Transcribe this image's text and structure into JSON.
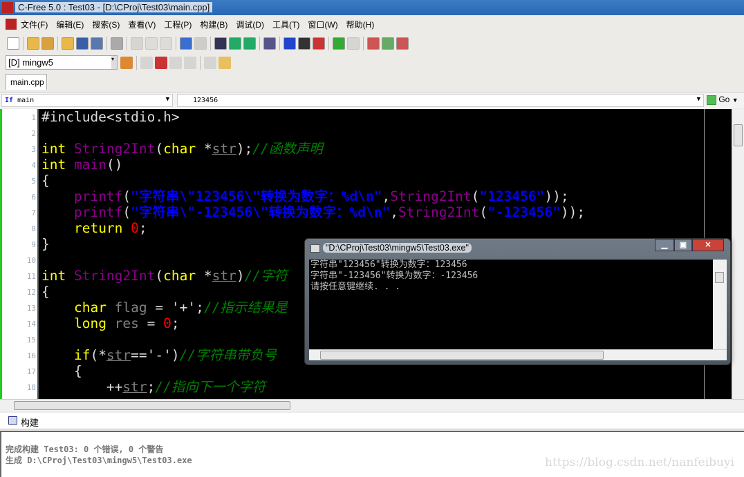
{
  "window": {
    "title": "C-Free 5.0 : Test03 - [D:\\CProj\\Test03\\main.cpp]",
    "logo": "CF"
  },
  "menu": [
    "文件(F)",
    "编辑(E)",
    "搜索(S)",
    "查看(V)",
    "工程(P)",
    "构建(B)",
    "调试(D)",
    "工具(T)",
    "窗口(W)",
    "帮助(H)"
  ],
  "toolbar1": [
    "new-file-icon",
    "open-folder-icon",
    "open-project-icon",
    "open-icon",
    "save-icon",
    "save-all-icon",
    "print-icon",
    "cut-icon",
    "copy-icon",
    "paste-icon",
    "undo-icon",
    "redo-icon",
    "find-icon",
    "find-next-icon",
    "find-prev-icon",
    "find-in-files-icon",
    "bookmark-icon",
    "bookmark-config-icon",
    "clear-bookmark-icon",
    "back-icon",
    "forward-icon",
    "build-icon",
    "run-icon",
    "clear-icon"
  ],
  "toolbar2": {
    "compiler": "[D] mingw5",
    "icons": [
      "switch-compiler-icon",
      "run-icon",
      "stop-icon",
      "step-over-icon",
      "step-into-icon",
      "breakpoints-icon",
      "hand-icon"
    ]
  },
  "tabs": [
    {
      "label": "main.cpp",
      "active": true
    }
  ],
  "navbar": {
    "function": "main",
    "function_icon": "If",
    "symbol": "123456",
    "go_label": "Go"
  },
  "code": [
    [
      [
        "pu",
        "#include<stdio.h>"
      ]
    ],
    [],
    [
      [
        "kw",
        "int "
      ],
      [
        "fn",
        "String2Int"
      ],
      [
        "pu",
        "("
      ],
      [
        "kw",
        "char "
      ],
      [
        "pu",
        "*"
      ],
      [
        "va",
        "str"
      ],
      [
        "pu",
        ");"
      ],
      [
        "cm",
        "//函数声明"
      ]
    ],
    [
      [
        "kw",
        "int "
      ],
      [
        "fn",
        "main"
      ],
      [
        "pu",
        "()"
      ]
    ],
    [
      [
        "pu",
        "{"
      ]
    ],
    [
      [
        "pu",
        "    "
      ],
      [
        "fn",
        "printf"
      ],
      [
        "pu",
        "("
      ],
      [
        "st",
        "\"字符串\\\"123456\\\"转换为数字：%d\\n\""
      ],
      [
        "pu",
        ","
      ],
      [
        "fn",
        "String2Int"
      ],
      [
        "pu",
        "("
      ],
      [
        "st",
        "\"123456\""
      ],
      [
        "pu",
        "));"
      ]
    ],
    [
      [
        "pu",
        "    "
      ],
      [
        "fn",
        "printf"
      ],
      [
        "pu",
        "("
      ],
      [
        "st",
        "\"字符串\\\"-123456\\\"转换为数字：%d\\n\""
      ],
      [
        "pu",
        ","
      ],
      [
        "fn",
        "String2Int"
      ],
      [
        "pu",
        "("
      ],
      [
        "st",
        "\"-123456\""
      ],
      [
        "pu",
        "));"
      ]
    ],
    [
      [
        "pu",
        "    "
      ],
      [
        "kw",
        "return "
      ],
      [
        "nu",
        "0"
      ],
      [
        "pu",
        ";"
      ]
    ],
    [
      [
        "pu",
        "}"
      ]
    ],
    [],
    [
      [
        "kw",
        "int "
      ],
      [
        "fn",
        "String2Int"
      ],
      [
        "pu",
        "("
      ],
      [
        "kw",
        "char "
      ],
      [
        "pu",
        "*"
      ],
      [
        "va",
        "str"
      ],
      [
        "pu",
        ")"
      ],
      [
        "cm",
        "//字符"
      ]
    ],
    [
      [
        "pu",
        "{"
      ]
    ],
    [
      [
        "pu",
        "    "
      ],
      [
        "kw",
        "char "
      ],
      [
        "id",
        "flag"
      ],
      [
        "pu",
        " = '+';"
      ],
      [
        "cm",
        "//指示结果是"
      ]
    ],
    [
      [
        "pu",
        "    "
      ],
      [
        "kw",
        "long "
      ],
      [
        "id",
        "res"
      ],
      [
        "pu",
        " = "
      ],
      [
        "nu",
        "0"
      ],
      [
        "pu",
        ";"
      ]
    ],
    [],
    [
      [
        "pu",
        "    "
      ],
      [
        "kw",
        "if"
      ],
      [
        "pu",
        "(*"
      ],
      [
        "va",
        "str"
      ],
      [
        "pu",
        "=='-')"
      ],
      [
        "cm",
        "//字符串带负号"
      ]
    ],
    [
      [
        "pu",
        "    {"
      ]
    ],
    [
      [
        "pu",
        "        ++"
      ],
      [
        "va",
        "str"
      ],
      [
        "pu",
        ";"
      ],
      [
        "cm",
        "//指向下一个字符"
      ]
    ]
  ],
  "console": {
    "title": "\"D:\\CProj\\Test03\\mingw5\\Test03.exe\"",
    "lines": [
      "字符串\"123456\"转换为数字：123456",
      "字符串\"-123456\"转换为数字：-123456",
      "请按任意键继续. . ."
    ]
  },
  "build": {
    "tab": "构建",
    "lines": [
      "完成构建 Test03: 0 个错误, 0 个警告",
      "生成 D:\\CProj\\Test03\\mingw5\\Test03.exe"
    ]
  },
  "watermark": "https://blog.csdn.net/nanfeibuyi"
}
